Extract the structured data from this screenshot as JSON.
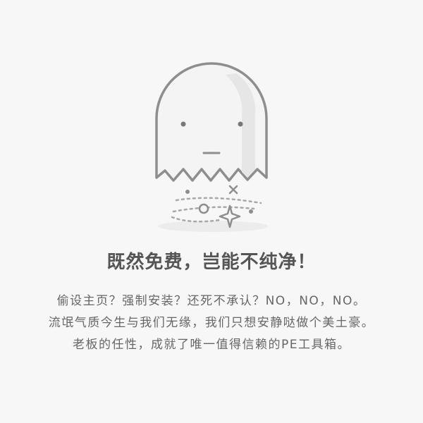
{
  "empty_state": {
    "illustration_icon": "ghost-icon",
    "headline": "既然免费，岂能不纯净！",
    "description_lines": [
      "偷设主页？强制安装？还死不承认？NO，NO，NO。",
      "流氓气质今生与我们无缘，我们只想安静哒做个美土豪。",
      "老板的任性，成就了唯一值得信赖的PE工具箱。"
    ]
  },
  "colors": {
    "background": "#f7f7f7",
    "ghost_stroke": "#8e8e8e",
    "ghost_fill": "#ececec",
    "headline": "#555555",
    "description": "#666666"
  }
}
